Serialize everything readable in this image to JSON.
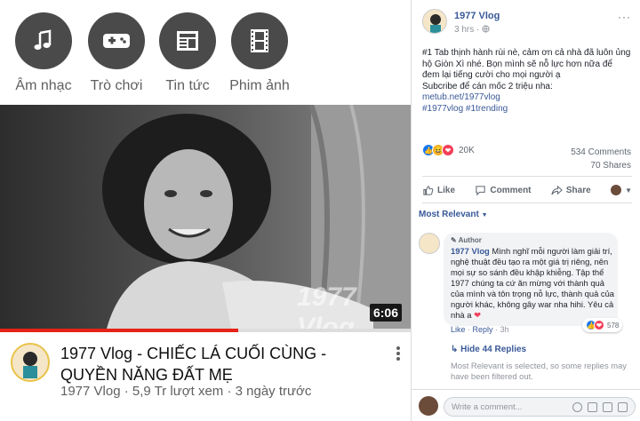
{
  "categories": [
    {
      "label": "Âm nhạc",
      "icon": "music-note-icon"
    },
    {
      "label": "Trò chơi",
      "icon": "gamepad-icon"
    },
    {
      "label": "Tin tức",
      "icon": "newspaper-icon"
    },
    {
      "label": "Phim ảnh",
      "icon": "film-icon"
    }
  ],
  "video": {
    "duration": "6:06",
    "watermark": "1977 Vlog",
    "progress_fraction": 0.58,
    "title": "1977 Vlog - CHIẾC LÁ CUỐI CÙNG - QUYỀN NĂNG ĐẤT MẸ",
    "meta": "1977 Vlog · 5,9 Tr lượt xem · 3 ngày trước"
  },
  "facebook": {
    "page_name": "1977 Vlog",
    "time": "3 hrs",
    "options": "···",
    "post": {
      "lines": [
        "#1 Tab thịnh hành rùi nè, cảm ơn cả nhà đã luôn ủng",
        "hộ Giòn Xì nhé. Bọn mình sẽ nỗ lực hơn nữa để",
        "đem lại tiếng cười cho mọi người ạ",
        "Subcribe để cán mốc 2 triệu nha:"
      ],
      "link": "metub.net/1977vlog",
      "hashtags": "#1977vlog #1trending"
    },
    "reaction_count": "20K",
    "comments_count": "534 Comments",
    "shares_count": "70 Shares",
    "actions": {
      "like": "Like",
      "comment": "Comment",
      "share": "Share"
    },
    "sort_label": "Most Relevant",
    "comment": {
      "badge": "Author",
      "author": "1977 Vlog",
      "first_line": " Mình nghĩ mỗi người làm giải trí,",
      "lines": [
        "nghệ thuật đều tạo ra một giá trị riêng, nên",
        "mọi sự so sánh đều khập khiễng. Tập thể",
        "1977 chúng ta cứ ăn mừng với thành quả",
        "của mình và tôn trọng nỗ lực, thành quả của",
        "người khác, không gây war nha hihi. Yêu cả",
        "nhà a"
      ],
      "reaction_count": "578",
      "like": "Like",
      "reply": "Reply",
      "time": "3h"
    },
    "hide_replies": "Hide 44 Replies",
    "filter_note": "Most Relevant is selected, so some replies may have been filtered out.",
    "write_placeholder": "Write a comment...",
    "colors": {
      "link_blue": "#385898",
      "like_blue": "#1877f2",
      "haha_yellow": "#f7b125",
      "love_red": "#f33e58",
      "progress_red": "#e62117"
    }
  }
}
